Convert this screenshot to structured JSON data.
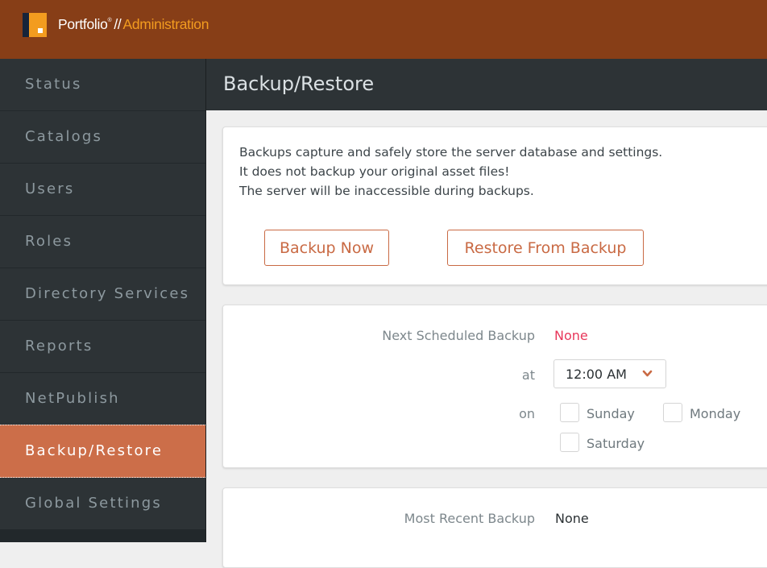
{
  "header": {
    "brand_name": "Portfolio",
    "brand_reg": "®",
    "separator": "//",
    "brand_section": "Administration",
    "logo_icon": "portfolio-logo-icon"
  },
  "sidebar": {
    "items": [
      {
        "label": "Status",
        "active": false
      },
      {
        "label": "Catalogs",
        "active": false
      },
      {
        "label": "Users",
        "active": false
      },
      {
        "label": "Roles",
        "active": false
      },
      {
        "label": "Directory Services",
        "active": false
      },
      {
        "label": "Reports",
        "active": false
      },
      {
        "label": "NetPublish",
        "active": false
      },
      {
        "label": "Backup/Restore",
        "active": true
      },
      {
        "label": "Global Settings",
        "active": false
      }
    ]
  },
  "page": {
    "title": "Backup/Restore"
  },
  "backup_card": {
    "info_lines": [
      "Backups capture and safely store the server database and settings.",
      "It does not backup your original asset files!",
      "The server will be inaccessible during backups."
    ],
    "backup_now_label": "Backup Now",
    "restore_label": "Restore From Backup"
  },
  "schedule_card": {
    "next_label": "Next Scheduled Backup",
    "next_value": "None",
    "at_label": "at",
    "time_value": "12:00 AM",
    "on_label": "on",
    "days": [
      {
        "label": "Sunday",
        "checked": false
      },
      {
        "label": "Monday",
        "checked": false
      },
      {
        "label": "Saturday",
        "checked": false
      }
    ]
  },
  "recent_card": {
    "label": "Most Recent Backup",
    "value": "None"
  },
  "colors": {
    "topbar": "#873e17",
    "accent": "#cc6e49",
    "brand_orange": "#f39c1f",
    "sidebar": "#2d3336",
    "none_red": "#e8365a"
  }
}
